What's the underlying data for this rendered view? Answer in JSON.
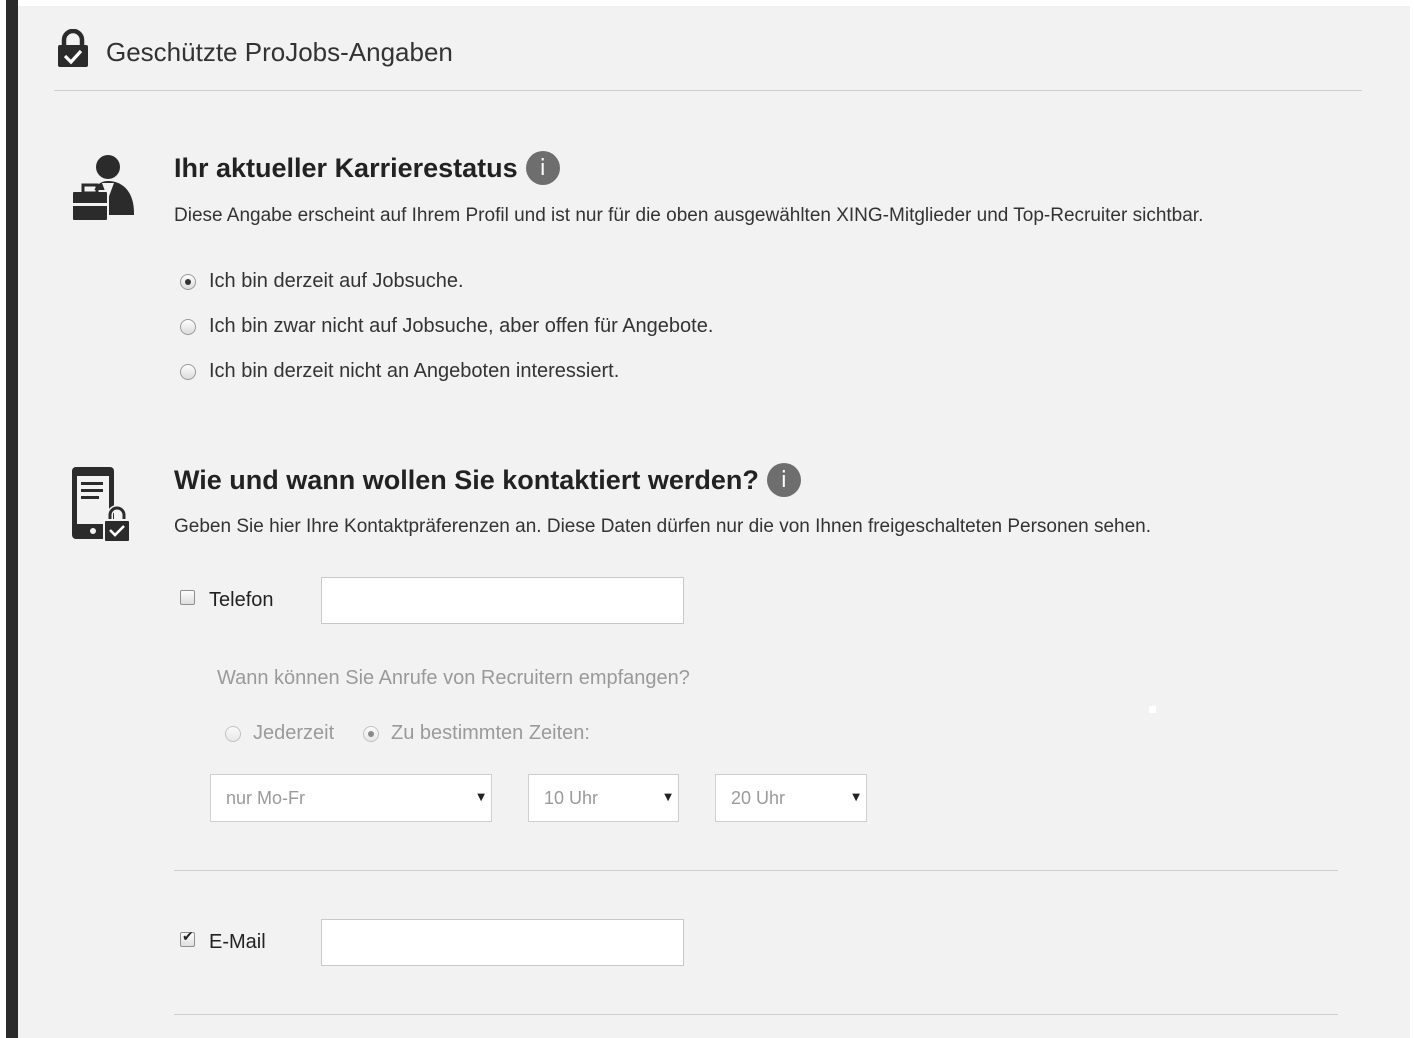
{
  "header": {
    "icon": "lock-check-icon",
    "title": "Geschützte ProJobs-Angaben"
  },
  "career": {
    "icon": "person-briefcase-icon",
    "title": "Ihr aktueller Karrierestatus",
    "info_icon": "info-icon",
    "info_symbol": "i",
    "description": "Diese Angabe erscheint auf Ihrem Profil und ist nur für die oben ausgewählten XING-Mitglieder und Top-Recruiter sichtbar.",
    "options": [
      {
        "label": "Ich bin derzeit auf Jobsuche.",
        "selected": true
      },
      {
        "label": "Ich bin zwar nicht auf Jobsuche, aber offen für Angebote.",
        "selected": false
      },
      {
        "label": "Ich bin derzeit nicht an Angeboten interessiert.",
        "selected": false
      }
    ]
  },
  "contact": {
    "icon": "phone-document-lock-icon",
    "title": "Wie und wann wollen Sie kontaktiert werden?",
    "info_icon": "info-icon",
    "info_symbol": "i",
    "description": "Geben Sie hier Ihre Kontaktpräferenzen an. Diese Daten dürfen nur die von Ihnen freigeschalteten Personen sehen.",
    "phone": {
      "label": "Telefon",
      "checked": false,
      "value": ""
    },
    "call_question": "Wann können Sie Anrufe von Recruitern empfangen?",
    "call_options": [
      {
        "label": "Jederzeit",
        "selected": false
      },
      {
        "label": "Zu bestimmten Zeiten:",
        "selected": true
      }
    ],
    "days_select": {
      "value": "nur Mo-Fr"
    },
    "from_select": {
      "value": "10 Uhr"
    },
    "to_select": {
      "value": "20 Uhr"
    },
    "email": {
      "label": "E-Mail",
      "checked": true,
      "value": ""
    }
  },
  "colors": {
    "background": "#f2f2f2",
    "left_bar": "#2b2b2b",
    "info_badge": "#6e6e6e",
    "muted_text": "#9a9a9a"
  }
}
